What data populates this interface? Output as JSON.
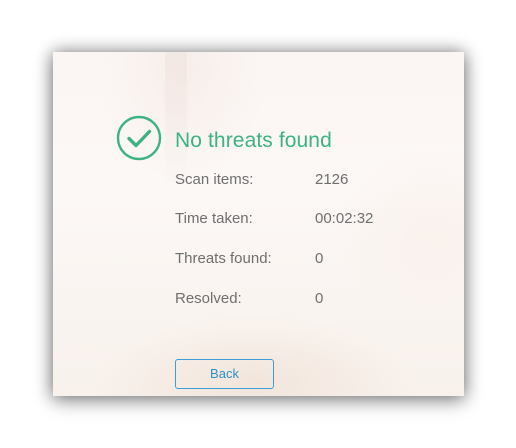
{
  "result": {
    "icon": "check-circle-icon",
    "title": "No threats found",
    "accent_color": "#3db384"
  },
  "stats": [
    {
      "label": "Scan items:",
      "value": "2126"
    },
    {
      "label": "Time taken:",
      "value": "00:02:32"
    },
    {
      "label": "Threats found:",
      "value": "0"
    },
    {
      "label": "Resolved:",
      "value": "0"
    }
  ],
  "actions": {
    "back_label": "Back",
    "button_color": "#3a9fd6"
  }
}
